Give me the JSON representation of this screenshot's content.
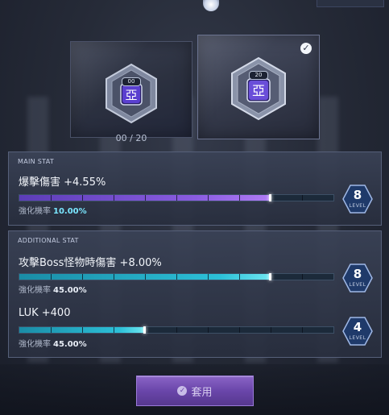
{
  "cards": {
    "current": {
      "emblem_char": "亞",
      "level_text": "00",
      "progress": "00 / 20"
    },
    "selected": {
      "emblem_char": "亞",
      "level_text": "20"
    }
  },
  "main_stat": {
    "title": "MAIN STAT",
    "stat": "爆擊傷害 +4.55%",
    "bar_fraction": 0.8,
    "rate_label": "強化機率",
    "rate_value": "10.00%",
    "level": "8",
    "level_label": "LEVEL"
  },
  "additional_stat": {
    "title": "ADDITIONAL STAT",
    "rows": [
      {
        "stat": "攻擊Boss怪物時傷害 +8.00%",
        "bar_fraction": 0.8,
        "rate_label": "強化機率",
        "rate_value": "45.00%",
        "level": "8",
        "level_label": "LEVEL"
      },
      {
        "stat": "LUK +400",
        "bar_fraction": 0.4,
        "rate_label": "強化機率",
        "rate_value": "45.00%",
        "level": "4",
        "level_label": "LEVEL"
      }
    ]
  },
  "apply_button": {
    "label": "套用"
  },
  "colors": {
    "accent_purple": "#8a5ce0",
    "accent_cyan": "#2cc0d8",
    "button": "#6a46aa"
  }
}
